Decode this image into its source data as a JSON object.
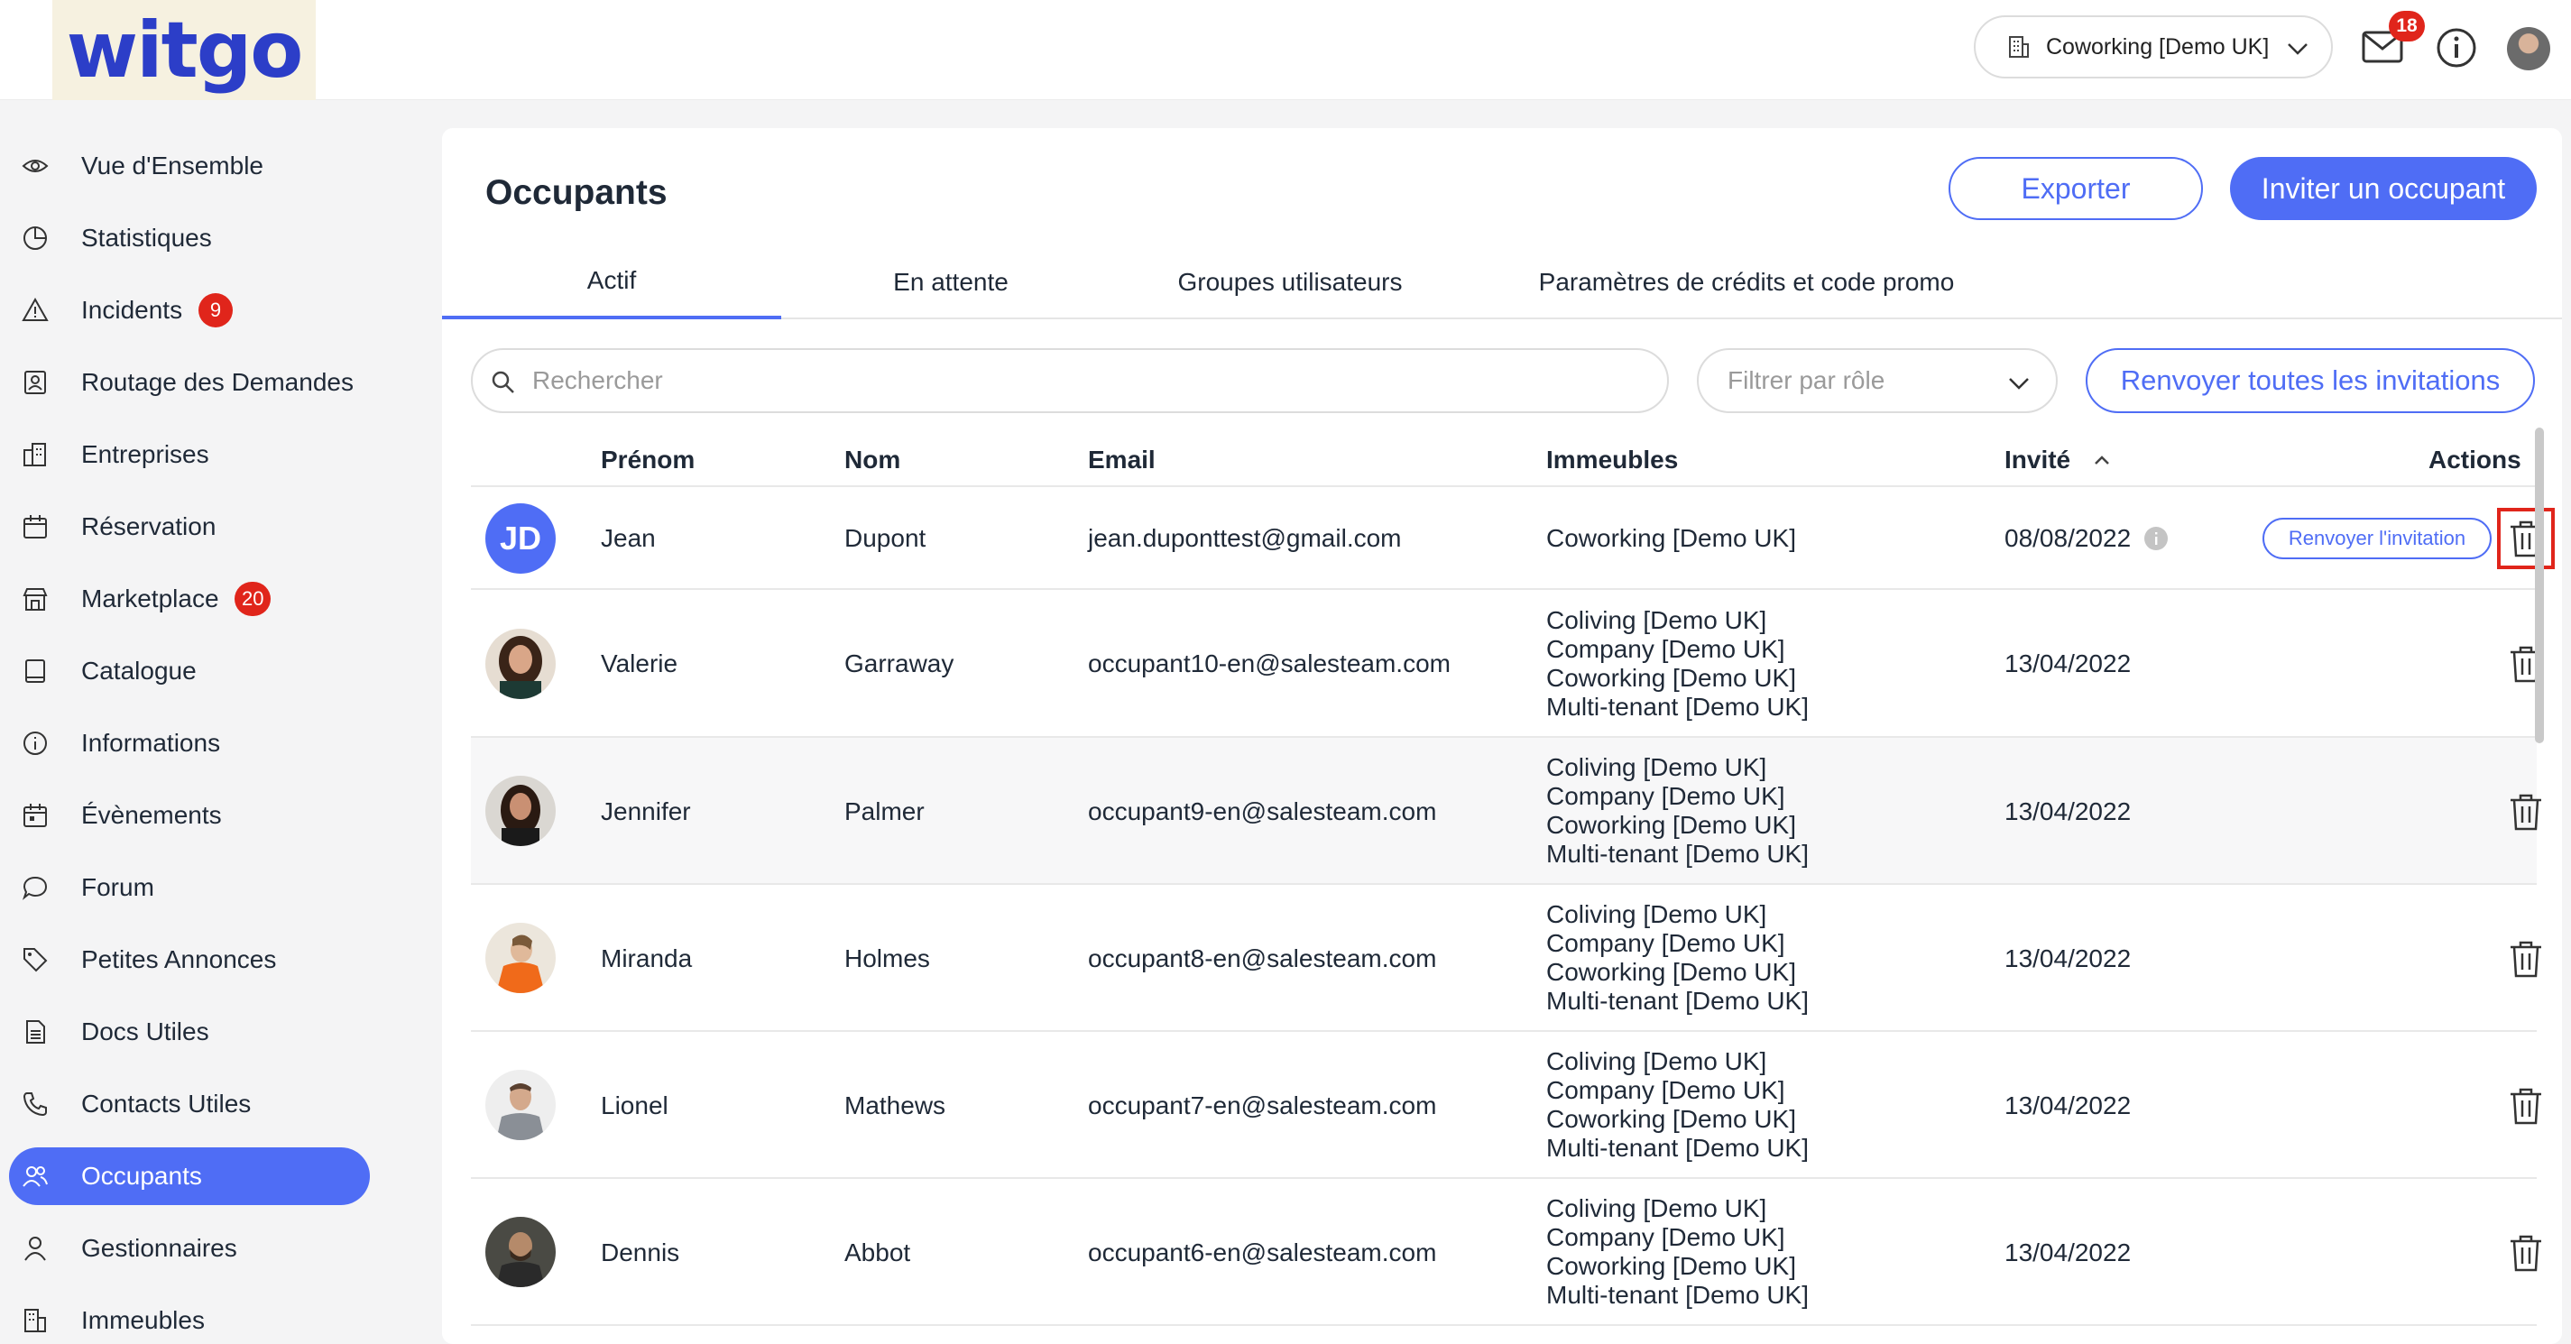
{
  "brand": {
    "logo_text": "witgo"
  },
  "topbar": {
    "building_selector": "Coworking [Demo UK]",
    "mail_badge": "18"
  },
  "sidebar": {
    "items": [
      {
        "label": "Vue d'Ensemble",
        "icon": "eye-icon"
      },
      {
        "label": "Statistiques",
        "icon": "pie-chart-icon"
      },
      {
        "label": "Incidents",
        "icon": "warning-icon",
        "badge": "9"
      },
      {
        "label": "Routage des Demandes",
        "icon": "contact-card-icon"
      },
      {
        "label": "Entreprises",
        "icon": "buildings-icon"
      },
      {
        "label": "Réservation",
        "icon": "calendar-icon"
      },
      {
        "label": "Marketplace",
        "icon": "store-icon",
        "badge": "20"
      },
      {
        "label": "Catalogue",
        "icon": "book-icon"
      },
      {
        "label": "Informations",
        "icon": "info-icon"
      },
      {
        "label": "Évènements",
        "icon": "event-calendar-icon"
      },
      {
        "label": "Forum",
        "icon": "chat-bubble-icon"
      },
      {
        "label": "Petites Annonces",
        "icon": "tag-icon"
      },
      {
        "label": "Docs Utiles",
        "icon": "document-icon"
      },
      {
        "label": "Contacts Utiles",
        "icon": "phone-icon"
      },
      {
        "label": "Occupants",
        "icon": "users-icon",
        "active": true
      },
      {
        "label": "Gestionnaires",
        "icon": "user-icon"
      },
      {
        "label": "Immeubles",
        "icon": "building-icon"
      }
    ]
  },
  "main": {
    "title": "Occupants",
    "export_label": "Exporter",
    "invite_label": "Inviter un occupant",
    "tabs": [
      "Actif",
      "En attente",
      "Groupes utilisateurs",
      "Paramètres de crédits et code promo"
    ],
    "search_placeholder": "Rechercher",
    "role_filter_placeholder": "Filtrer par rôle",
    "resend_all_label": "Renvoyer toutes les invitations",
    "columns": [
      "Prénom",
      "Nom",
      "Email",
      "Immeubles",
      "Invité",
      "Actions"
    ],
    "resend_label": "Renvoyer l'invitation",
    "rows": [
      {
        "initials": "JD",
        "first": "Jean",
        "last": "Dupont",
        "email": "jean.duponttest@gmail.com",
        "buildings": [
          "Coworking [Demo UK]"
        ],
        "invited": "08/08/2022",
        "pending": true
      },
      {
        "first": "Valerie",
        "last": "Garraway",
        "email": "occupant10-en@salesteam.com",
        "buildings": [
          "Coliving [Demo UK]",
          "Company [Demo UK]",
          "Coworking [Demo UK]",
          "Multi-tenant [Demo UK]"
        ],
        "invited": "13/04/2022"
      },
      {
        "first": "Jennifer",
        "last": "Palmer",
        "email": "occupant9-en@salesteam.com",
        "buildings": [
          "Coliving [Demo UK]",
          "Company [Demo UK]",
          "Coworking [Demo UK]",
          "Multi-tenant [Demo UK]"
        ],
        "invited": "13/04/2022"
      },
      {
        "first": "Miranda",
        "last": "Holmes",
        "email": "occupant8-en@salesteam.com",
        "buildings": [
          "Coliving [Demo UK]",
          "Company [Demo UK]",
          "Coworking [Demo UK]",
          "Multi-tenant [Demo UK]"
        ],
        "invited": "13/04/2022"
      },
      {
        "first": "Lionel",
        "last": "Mathews",
        "email": "occupant7-en@salesteam.com",
        "buildings": [
          "Coliving [Demo UK]",
          "Company [Demo UK]",
          "Coworking [Demo UK]",
          "Multi-tenant [Demo UK]"
        ],
        "invited": "13/04/2022"
      },
      {
        "first": "Dennis",
        "last": "Abbot",
        "email": "occupant6-en@salesteam.com",
        "buildings": [
          "Coliving [Demo UK]",
          "Company [Demo UK]",
          "Coworking [Demo UK]",
          "Multi-tenant [Demo UK]"
        ],
        "invited": "13/04/2022"
      }
    ]
  },
  "colors": {
    "accent": "#4f6df5",
    "badge": "#e0251b",
    "highlight": "#e0251b"
  }
}
